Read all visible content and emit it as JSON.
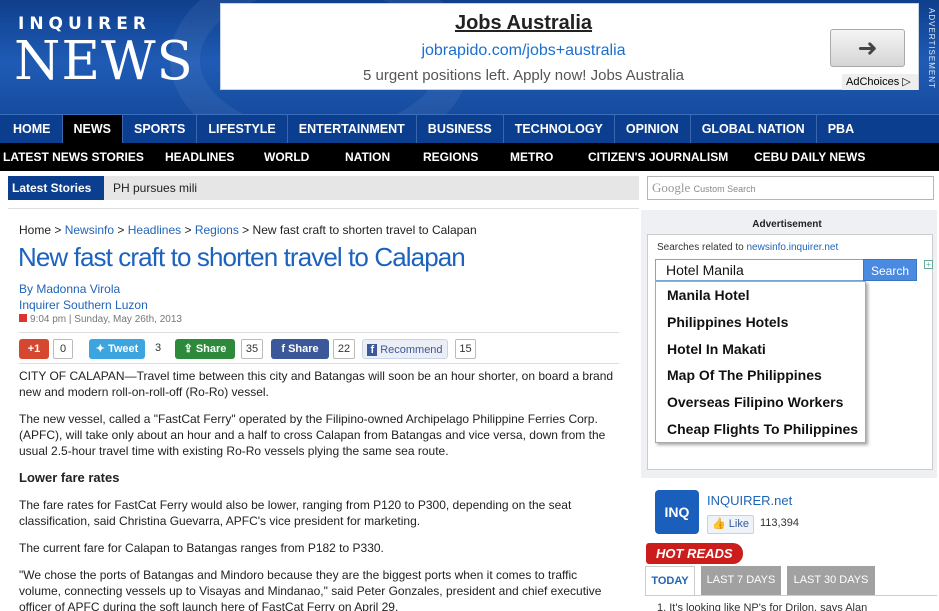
{
  "header": {
    "logo_top": "INQUIRER",
    "logo_main": "NEWS",
    "advertisement_vertical": "ADVERTISEMENT"
  },
  "top_ad": {
    "title": "Jobs Australia",
    "url": "jobrapido.com/jobs+australia",
    "description": "5 urgent positions left. Apply now! Jobs Australia",
    "adchoices": "AdChoices ▷",
    "arrow_icon": "arrow-right-icon"
  },
  "nav_primary": [
    "HOME",
    "NEWS",
    "SPORTS",
    "LIFESTYLE",
    "ENTERTAINMENT",
    "BUSINESS",
    "TECHNOLOGY",
    "OPINION",
    "GLOBAL NATION",
    "PBA"
  ],
  "nav_primary_active": "NEWS",
  "nav_secondary": [
    "LATEST NEWS STORIES",
    "HEADLINES",
    "WORLD",
    "NATION",
    "REGIONS",
    "METRO",
    "CITIZEN'S JOURNALISM",
    "CEBU DAILY NEWS"
  ],
  "latest": {
    "label": "Latest Stories",
    "ticker": "PH pursues mili"
  },
  "search": {
    "google": "Google",
    "custom": "Custom Search"
  },
  "article": {
    "breadcrumb": {
      "home": "Home",
      "newsinfo": "Newsinfo",
      "headlines": "Headlines",
      "regions": "Regions",
      "current": "New fast craft to shorten travel to Calapan"
    },
    "headline": "New fast craft to shorten travel to Calapan",
    "author": "By Madonna Virola",
    "source": "Inquirer Southern Luzon",
    "date": "9:04 pm | Sunday, May 26th, 2013",
    "share": {
      "gplus_label": "+1",
      "gplus_count": "0",
      "tweet_label": "Tweet",
      "tweet_count": "3",
      "share_label": "Share",
      "share_count": "35",
      "fb_share_label": "Share",
      "fb_share_count": "22",
      "recommend_label": "Recommend",
      "recommend_count": "15"
    },
    "paragraphs": [
      "CITY OF CALAPAN—Travel time between this city and Batangas will soon be an hour shorter, on board a brand new and modern roll-on-roll-off (Ro-Ro) vessel.",
      "The new vessel, called a \"FastCat Ferry\" operated by the Filipino-owned Archipelago Philippine Ferries Corp. (APFC), will take only about an hour and a half to cross Calapan from Batangas and vice versa, down from the usual 2.5-hour travel time with existing Ro-Ro vessels plying the same sea route."
    ],
    "subhead": "Lower fare rates",
    "paragraphs2": [
      "The fare rates for FastCat Ferry would also be lower, ranging from P120 to P300, depending on the seat classification, said Christina Guevarra, APFC's vice president for marketing.",
      "The current fare for Calapan to Batangas ranges from P182 to P330.",
      "\"We chose the ports of Batangas and Mindoro because they are the biggest ports when it comes to traffic volume, connecting vessels up to Visayas and Mindanao,\" said Peter Gonzales, president and chief executive officer of APFC during the soft launch here of FastCat Ferry on April 29."
    ]
  },
  "side_ad": {
    "label": "Advertisement",
    "searches_prefix": "Searches related to",
    "searches_site": "newsinfo.inquirer.net",
    "input_value": "Hotel Manila",
    "button": "Search",
    "options": [
      "Manila Hotel",
      "Philippines Hotels",
      "Hotel In Makati",
      "Map Of The Philippines",
      "Overseas Filipino Workers",
      "Cheap Flights To Philippines"
    ]
  },
  "inquirer_net": {
    "logo": "INQ",
    "name": "INQUIRER.net",
    "like": "Like",
    "count": "113,394"
  },
  "hot_reads": {
    "label": "HOT READS",
    "tabs": [
      "TODAY",
      "LAST 7 DAYS",
      "LAST 30 DAYS"
    ],
    "active_tab": "TODAY",
    "first_item": "1.  It's looking like NP's for Drilon, says Alan"
  }
}
